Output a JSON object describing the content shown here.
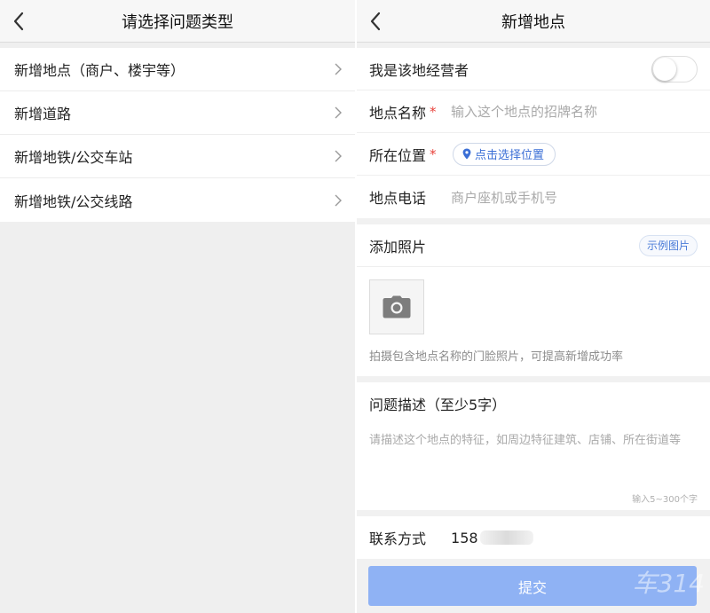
{
  "left": {
    "title": "请选择问题类型",
    "items": [
      {
        "label": "新增地点（商户、楼宇等）"
      },
      {
        "label": "新增道路"
      },
      {
        "label": "新增地铁/公交车站"
      },
      {
        "label": "新增地铁/公交线路"
      }
    ]
  },
  "right": {
    "title": "新增地点",
    "owner": {
      "label": "我是该地经营者",
      "toggle_on": false
    },
    "name": {
      "label": "地点名称",
      "required_mark": "*",
      "placeholder": "输入这个地点的招牌名称"
    },
    "location": {
      "label": "所在位置",
      "required_mark": "*",
      "button": "点击选择位置"
    },
    "phone": {
      "label": "地点电话",
      "placeholder": "商户座机或手机号"
    },
    "photo": {
      "label": "添加照片",
      "sample_button": "示例图片",
      "hint": "拍摄包含地点名称的门脸照片，可提高新增成功率"
    },
    "description": {
      "label": "问题描述（至少5字）",
      "placeholder": "请描述这个地点的特征，如周边特征建筑、店铺、所在街道等",
      "counter": "输入5~300个字"
    },
    "contact": {
      "label": "联系方式",
      "value": "158"
    },
    "submit": "提交",
    "watermark": "车314"
  },
  "colors": {
    "accent": "#3b6fd6",
    "submit_bg": "#8fb2f4",
    "required": "#e8423b"
  },
  "icons": {
    "back": "chevron-left-icon",
    "arrow": "chevron-right-icon",
    "location": "map-pin-icon",
    "camera": "camera-icon"
  }
}
